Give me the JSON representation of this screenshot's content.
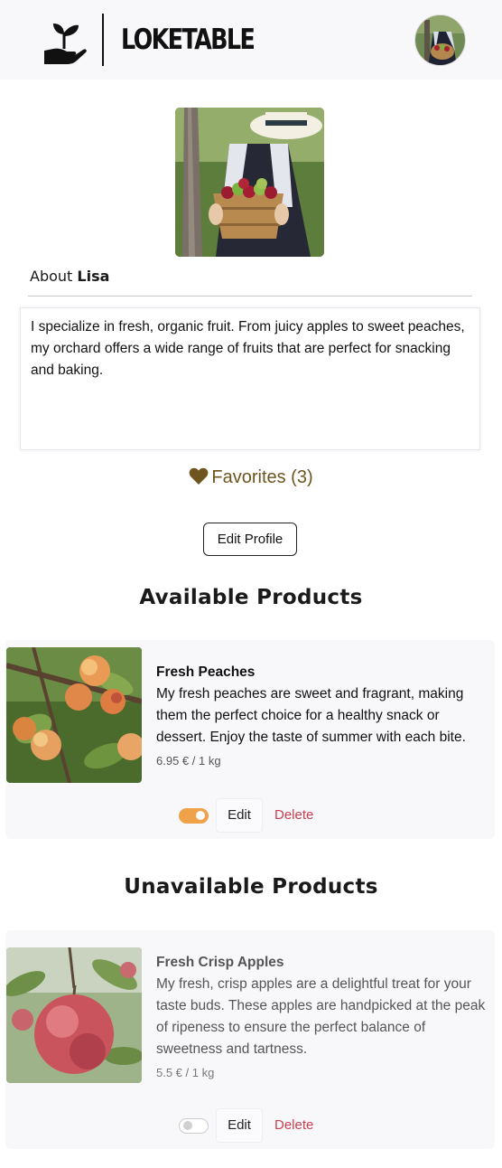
{
  "header": {
    "brand": "LOKETABLE",
    "logo_icon": "hand-sprout-icon",
    "avatar_icon": "user-avatar"
  },
  "profile": {
    "photo_icon": "farmer-with-apple-basket-photo",
    "about_label": "About",
    "name": "Lisa",
    "bio": "I specialize in fresh, organic fruit. From juicy apples to sweet peaches, my orchard offers a wide range of fruits that are perfect for snacking and baking.",
    "favorites_label": "Favorites (3)",
    "favorites_icon": "heart-icon",
    "edit_profile_label": "Edit Profile"
  },
  "available": {
    "title": "Available Products",
    "products": [
      {
        "name": "Fresh Peaches",
        "description": "My fresh peaches are sweet and fragrant, making them the perfect choice for a healthy snack or dessert. Enjoy the taste of summer with each bite.",
        "price": "6.95 € / 1 kg",
        "available": true,
        "edit_label": "Edit",
        "delete_label": "Delete"
      }
    ]
  },
  "unavailable": {
    "title": "Unavailable Products",
    "products": [
      {
        "name": "Fresh Crisp Apples",
        "description": "My fresh, crisp apples are a delightful treat for your taste buds. These apples are handpicked at the peak of ripeness to ensure the perfect balance of sweetness and tartness.",
        "price": "5.5 € / 1 kg",
        "available": false,
        "edit_label": "Edit",
        "delete_label": "Delete"
      }
    ]
  },
  "colors": {
    "accent_toggle": "#f0a24a",
    "favorites": "#6e5520",
    "delete": "#c94150",
    "card_bg": "#f8f8fb"
  }
}
